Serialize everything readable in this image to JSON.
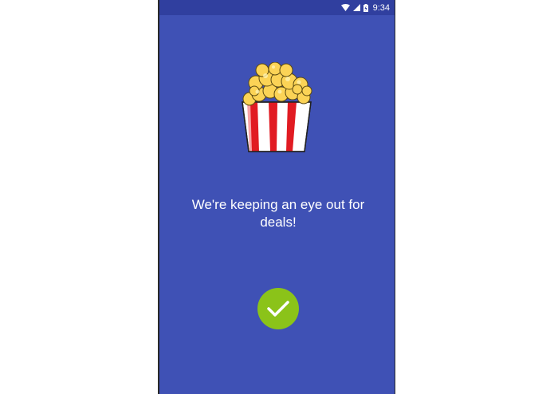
{
  "status_bar": {
    "time": "9:34",
    "icons": [
      "wifi-icon",
      "signal-icon",
      "battery-charging-icon"
    ]
  },
  "main": {
    "illustration": "popcorn-icon",
    "message": "We're keeping an eye out for deals!",
    "confirm_icon": "check-icon"
  },
  "colors": {
    "background": "#3f51b5",
    "status_bar": "#303f9f",
    "confirm_button": "#8bc319"
  }
}
